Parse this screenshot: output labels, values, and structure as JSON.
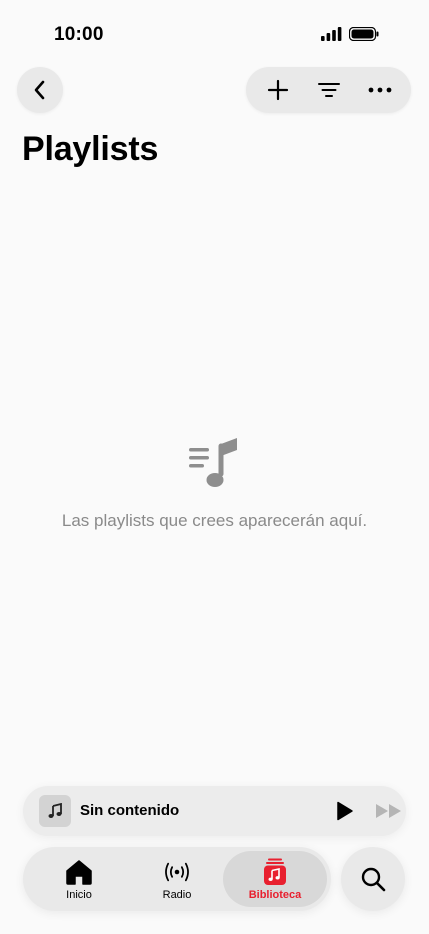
{
  "status_bar": {
    "time": "10:00"
  },
  "header": {
    "title": "Playlists",
    "back_icon": "chevron-left-icon",
    "actions": [
      "plus-icon",
      "filter-lines-icon",
      "ellipsis-icon"
    ]
  },
  "empty_state": {
    "icon": "playlist-music-icon",
    "message": "Las playlists que crees aparecerán aquí."
  },
  "mini_player": {
    "title": "Sin contenido",
    "play_icon": "play-icon",
    "next_icon": "fast-forward-icon"
  },
  "tabs": [
    {
      "label": "Inicio",
      "icon": "home-icon",
      "active": false
    },
    {
      "label": "Radio",
      "icon": "radio-waves-icon",
      "active": false
    },
    {
      "label": "Biblioteca",
      "icon": "library-icon",
      "active": true
    }
  ],
  "search_icon": "search-icon",
  "colors": {
    "accent": "#e8202f",
    "muted_text": "#8a8a8a",
    "control_bg": "#e9e9e9"
  }
}
